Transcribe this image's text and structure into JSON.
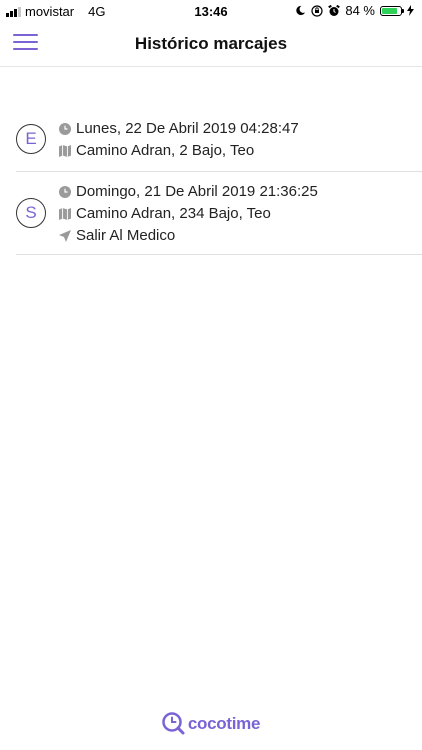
{
  "status_bar": {
    "carrier": "movistar",
    "network": "4G",
    "time": "13:46",
    "battery": "84 %",
    "battery_level": 0.84
  },
  "header": {
    "title": "Histórico marcajes",
    "menu_icon": "hamburger-icon"
  },
  "records": [
    {
      "initial": "E",
      "datetime": "Lunes, 22 De Abril 2019 04:28:47",
      "address": "Camino Adran, 2 Bajo, Teo"
    },
    {
      "initial": "S",
      "datetime": "Domingo, 21 De Abril 2019 21:36:25",
      "address": "Camino Adran, 234 Bajo, Teo",
      "note": "Salir Al Medico"
    }
  ],
  "footer": {
    "logo_text": "cocotime"
  },
  "colors": {
    "accent": "#7b63d6",
    "icon_gray": "#9a9a9a",
    "divider": "#e0e0e0"
  }
}
